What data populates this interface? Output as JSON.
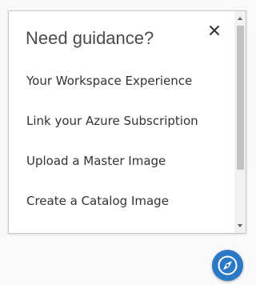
{
  "guidance_panel": {
    "title": "Need guidance?",
    "close_icon": "close-icon",
    "items": [
      {
        "label": "Your Workspace Experience"
      },
      {
        "label": "Link your Azure Subscription"
      },
      {
        "label": "Upload a Master Image"
      },
      {
        "label": "Create a Catalog Image"
      }
    ]
  },
  "scrollbar": {
    "up_icon": "scroll-up-arrow-icon",
    "down_icon": "scroll-down-arrow-icon"
  },
  "guidance_button": {
    "icon": "compass-icon",
    "color": "#2b78c5"
  }
}
